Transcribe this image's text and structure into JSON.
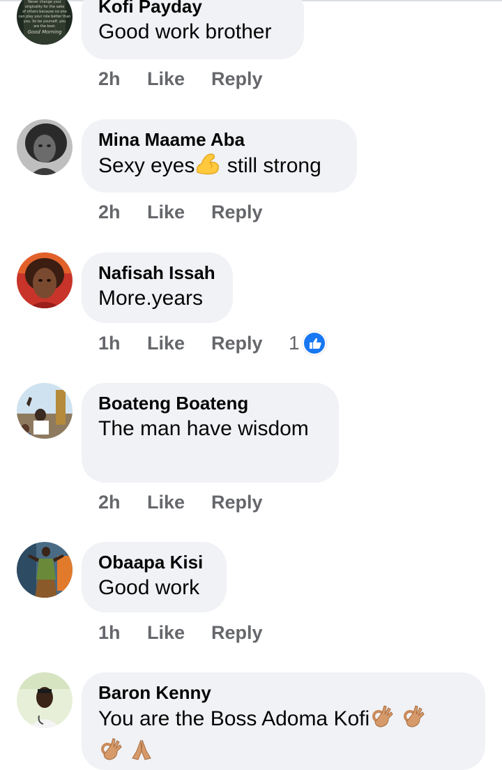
{
  "comments": [
    {
      "author": "Kofi Payday",
      "text": "Good work brother",
      "time": "2h",
      "like_label": "Like",
      "reply_label": "Reply",
      "avatar_text": [
        "Never change your",
        "originality for the sake",
        "of others because no one",
        "can play your role better than",
        "you. So be yourself, you",
        "are the best.",
        "Good Morning"
      ]
    },
    {
      "author": "Mina Maame Aba",
      "text_before": "Sexy eyes",
      "emoji": "flexed-biceps",
      "text_after": " still strong",
      "time": "2h",
      "like_label": "Like",
      "reply_label": "Reply"
    },
    {
      "author": "Nafisah Issah",
      "text": "More.years",
      "time": "1h",
      "like_label": "Like",
      "reply_label": "Reply",
      "reaction_count": "1",
      "reaction_icon": "thumbs-up-icon"
    },
    {
      "author": "Boateng Boateng",
      "text": "The man have wisdom",
      "time": "2h",
      "like_label": "Like",
      "reply_label": "Reply"
    },
    {
      "author": "Obaapa Kisi",
      "text": "Good work",
      "time": "1h",
      "like_label": "Like",
      "reply_label": "Reply"
    },
    {
      "author": "Baron Kenny",
      "text": "You are the Boss Adoma Kofi",
      "emojis": [
        "ok-hand",
        "ok-hand",
        "ok-hand",
        "folded-hands"
      ]
    }
  ],
  "colors": {
    "bubble": "#f0f2f5",
    "meta": "#65676b",
    "like_blue": "#1877f2"
  }
}
